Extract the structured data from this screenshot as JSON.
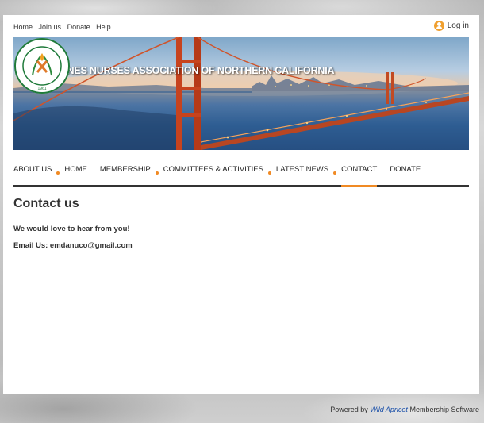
{
  "topnav": {
    "items": [
      "Home",
      "Join us",
      "Donate",
      "Help"
    ]
  },
  "login": {
    "label": "Log in"
  },
  "banner": {
    "title": "PHILIPPINES NURSES ASSOCIATION OF NORTHERN CALIFORNIA",
    "seal_text": "NURSES ASSOCIATION OF NORTHERN",
    "seal_year": "1961"
  },
  "mainnav": {
    "items": [
      "ABOUT US",
      "HOME",
      "MEMBERSHIP",
      "COMMITTEES & ACTIVITIES",
      "LATEST NEWS",
      "CONTACT",
      "DONATE"
    ],
    "active": "CONTACT",
    "accent_color": "#f08a24"
  },
  "content": {
    "title": "Contact us",
    "line1": "We would love to hear from you!",
    "line2": "Email Us: emdanuco@gmail.com"
  },
  "footer": {
    "prefix": "Powered by",
    "link": "Wild Apricot",
    "suffix": "Membership Software"
  }
}
